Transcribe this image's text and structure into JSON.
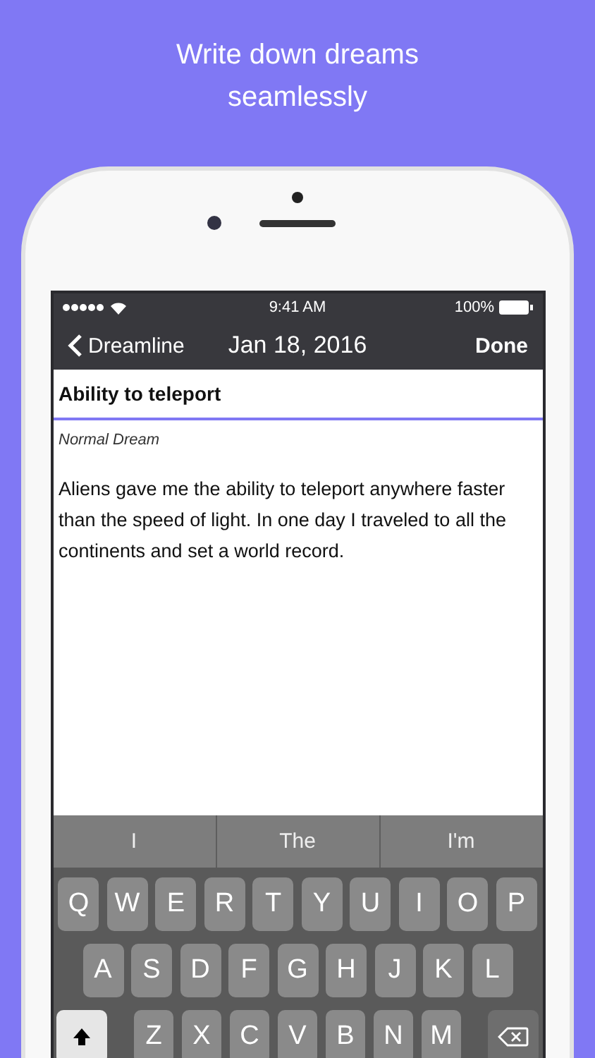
{
  "headline": "Write down dreams seamlessly",
  "status_bar": {
    "time": "9:41 AM",
    "battery": "100%"
  },
  "nav": {
    "back": "Dreamline",
    "title": "Jan 18, 2016",
    "action": "Done"
  },
  "entry": {
    "title": "Ability to teleport",
    "category": "Normal Dream",
    "text": "Aliens gave me the ability to teleport anywhere faster than the speed of light. In one day I traveled to all the continents and set a world record."
  },
  "suggestions": [
    "I",
    "The",
    "I'm"
  ],
  "keyboard": {
    "rows": [
      [
        "Q",
        "W",
        "E",
        "R",
        "T",
        "Y",
        "U",
        "I",
        "O",
        "P"
      ],
      [
        "A",
        "S",
        "D",
        "F",
        "G",
        "H",
        "J",
        "K",
        "L"
      ],
      [
        "Z",
        "X",
        "C",
        "V",
        "B",
        "N",
        "M"
      ]
    ],
    "shift_on": true
  }
}
